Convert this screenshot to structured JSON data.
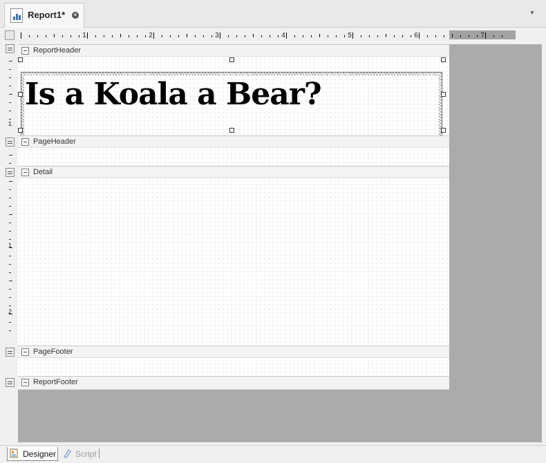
{
  "document_tab": {
    "title": "Report1*",
    "close_glyph": "×"
  },
  "tab_dropdown_glyph": "▾",
  "horizontal_ruler": {
    "numbers": [
      "1",
      "2",
      "3",
      "4",
      "5",
      "6",
      "7"
    ]
  },
  "vertical_ruler": {
    "numbers": [
      "1",
      "1",
      "2"
    ]
  },
  "bands": {
    "report_header": {
      "label": "ReportHeader"
    },
    "page_header": {
      "label": "PageHeader"
    },
    "detail": {
      "label": "Detail"
    },
    "page_footer": {
      "label": "PageFooter"
    },
    "report_footer": {
      "label": "ReportFooter"
    }
  },
  "title_textbox": {
    "text": "Is a Koala a Bear?"
  },
  "bottom_tabs": {
    "designer": "Designer",
    "script": "Script"
  },
  "colors": {
    "canvas": "#ababab",
    "page": "#ffffff",
    "band_header": "#f3f3f3"
  }
}
